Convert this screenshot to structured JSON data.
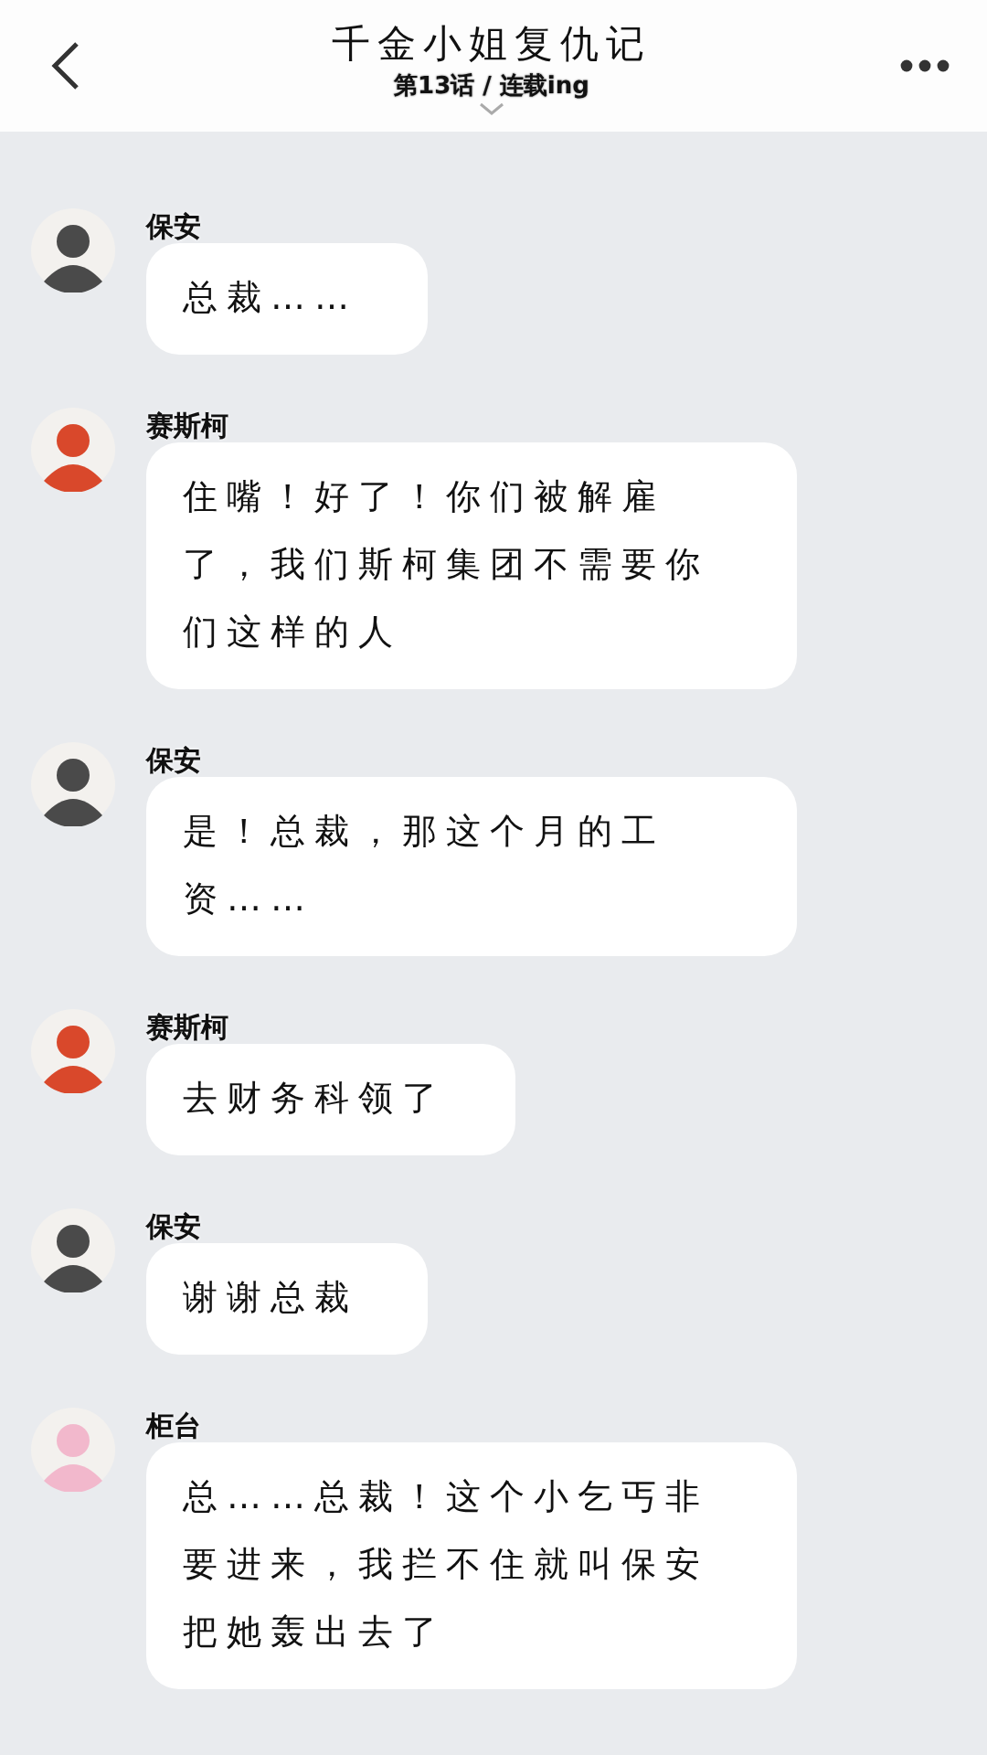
{
  "header": {
    "title": "千金小姐复仇记",
    "subtitle": "第13话 / 连载ing"
  },
  "messages": [
    {
      "sender": "保安",
      "color": "#4a4a4a",
      "text": "总裁……"
    },
    {
      "sender": "赛斯柯",
      "color": "#d9482b",
      "text": "住嘴！好了！你们被解雇了，我们斯柯集团不需要你们这样的人"
    },
    {
      "sender": "保安",
      "color": "#4a4a4a",
      "text": "是！总裁，那这个月的工资……"
    },
    {
      "sender": "赛斯柯",
      "color": "#d9482b",
      "text": "去财务科领了"
    },
    {
      "sender": "保安",
      "color": "#4a4a4a",
      "text": "谢谢总裁"
    },
    {
      "sender": "柜台",
      "color": "#f2b8cc",
      "text": "总……总裁！这个小乞丐非要进来，我拦不住就叫保安把她轰出去了"
    }
  ]
}
